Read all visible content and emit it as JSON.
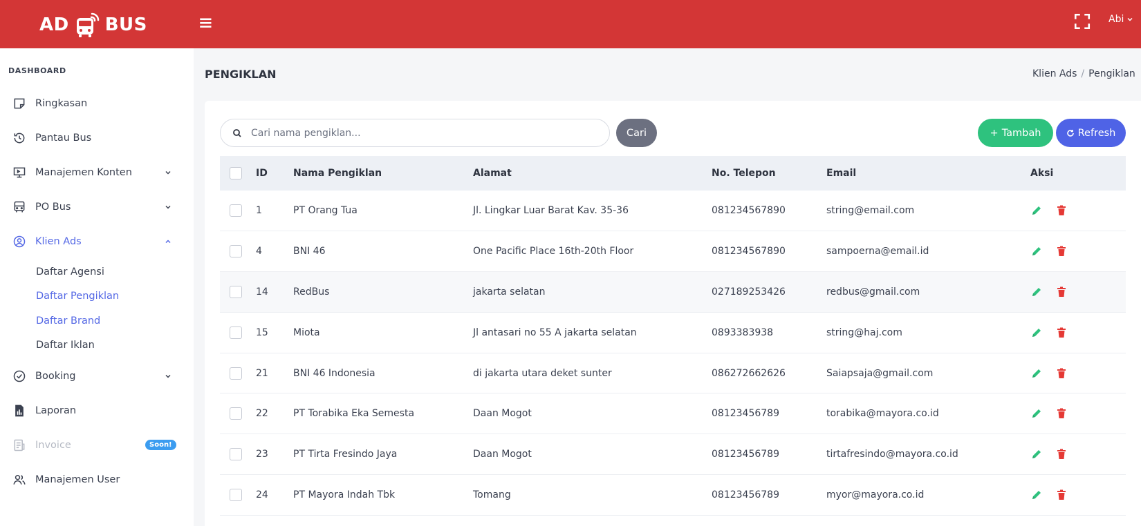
{
  "brand": {
    "left": "AD",
    "right": "BUS"
  },
  "header": {
    "user": "Abi"
  },
  "sidebar": {
    "section": "DASHBOARD",
    "items": [
      {
        "label": "Ringkasan"
      },
      {
        "label": "Pantau Bus"
      },
      {
        "label": "Manajemen Konten"
      },
      {
        "label": "PO Bus"
      },
      {
        "label": "Klien Ads"
      },
      {
        "label": "Booking"
      },
      {
        "label": "Laporan"
      },
      {
        "label": "Invoice",
        "badge": "Soon!"
      },
      {
        "label": "Manajemen User"
      }
    ],
    "sub_items": [
      {
        "label": "Daftar Agensi"
      },
      {
        "label": "Daftar Pengiklan"
      },
      {
        "label": "Daftar Brand"
      },
      {
        "label": "Daftar Iklan"
      }
    ]
  },
  "page": {
    "title": "PENGIKLAN",
    "breadcrumb": [
      "Klien Ads",
      "Pengiklan"
    ]
  },
  "search": {
    "placeholder": "Cari nama pengiklan...",
    "value": "",
    "button": "Cari"
  },
  "actions": {
    "add": "Tambah",
    "refresh": "Refresh"
  },
  "table": {
    "columns": [
      "ID",
      "Nama Pengiklan",
      "Alamat",
      "No. Telepon",
      "Email",
      "Aksi"
    ],
    "rows": [
      {
        "id": "1",
        "name": "PT Orang Tua",
        "address": "Jl. Lingkar Luar Barat Kav. 35-36",
        "phone": "081234567890",
        "email": "string@email.com"
      },
      {
        "id": "4",
        "name": "BNI 46",
        "address": "One Pacific Place 16th-20th Floor",
        "phone": "081234567890",
        "email": "sampoerna@email.id"
      },
      {
        "id": "14",
        "name": "RedBus",
        "address": "jakarta selatan",
        "phone": "027189253426",
        "email": "redbus@gmail.com"
      },
      {
        "id": "15",
        "name": "Miota",
        "address": "Jl antasari no 55 A jakarta selatan",
        "phone": "0893383938",
        "email": "string@haj.com"
      },
      {
        "id": "21",
        "name": "BNI 46 Indonesia",
        "address": "di jakarta utara deket sunter",
        "phone": "086272662626",
        "email": "Saiapsaja@gmail.com"
      },
      {
        "id": "22",
        "name": "PT Torabika Eka Semesta",
        "address": "Daan Mogot",
        "phone": "08123456789",
        "email": "torabika@mayora.co.id"
      },
      {
        "id": "23",
        "name": "PT Tirta Fresindo Jaya",
        "address": "Daan Mogot",
        "phone": "08123456789",
        "email": "tirtafresindo@mayora.co.id"
      },
      {
        "id": "24",
        "name": "PT Mayora Indah Tbk",
        "address": "Tomang",
        "phone": "08123456789",
        "email": "myor@mayora.co.id"
      }
    ]
  },
  "colors": {
    "header": "#d33636",
    "accent": "#5468e5",
    "add_button": "#2ec27e",
    "refresh_button": "#4f63e6",
    "search_button": "#6c7080",
    "edit_icon": "#2ec27e",
    "delete_icon": "#e53935",
    "soon_badge": "#3b9cf0"
  }
}
